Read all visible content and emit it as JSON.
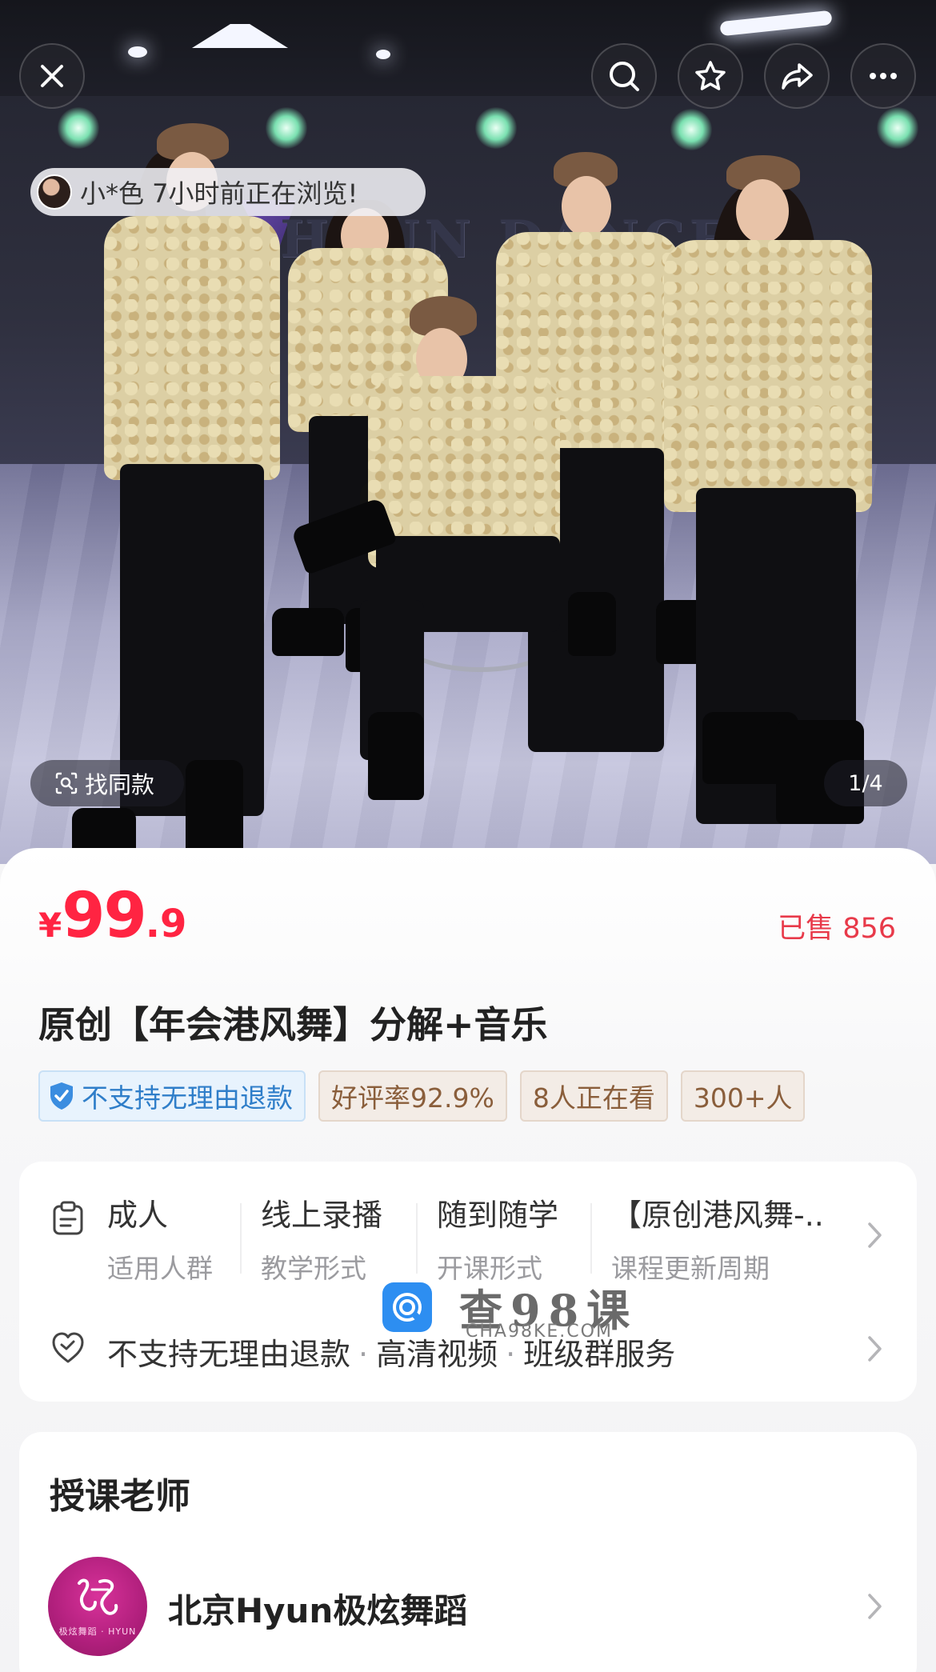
{
  "hero": {
    "sign_text": "HYUN DANCE",
    "viewer_notice": "小*色 7小时前正在浏览!",
    "find_similar_label": "找同款",
    "page_indicator": "1/4"
  },
  "topbar": {
    "icons": [
      "close-icon",
      "search-icon",
      "star-icon",
      "share-icon",
      "more-icon"
    ]
  },
  "product": {
    "price_currency": "¥",
    "price_integer": "99",
    "price_decimal": ".9",
    "sold_label": "已售 856",
    "title": "原创【年会港风舞】分解+音乐",
    "tags": [
      {
        "text": "不支持无理由退款",
        "type": "refund"
      },
      {
        "text": "好评率92.9%",
        "type": "gold"
      },
      {
        "text": "8人正在看",
        "type": "gold"
      },
      {
        "text": "300+人",
        "type": "gold"
      }
    ]
  },
  "attributes": [
    {
      "value": "成人",
      "key": "适用人群"
    },
    {
      "value": "线上录播",
      "key": "教学形式"
    },
    {
      "value": "随到随学",
      "key": "开课形式"
    },
    {
      "value": "【原创港风舞-..",
      "key": "课程更新周期"
    }
  ],
  "services": {
    "items": [
      "不支持无理由退款",
      "高清视频",
      "班级群服务"
    ],
    "separator": "·"
  },
  "watermark": {
    "main": "查98课",
    "sub": "CHA98KE.COM"
  },
  "teacher": {
    "heading": "授课老师",
    "name": "北京Hyun极炫舞蹈",
    "avatar_caption": "极炫舞蹈 · HYUN"
  },
  "colors": {
    "price_red": "#ff2442",
    "refund_blue": "#2f7ec9",
    "tag_brown": "#8a5e3b",
    "watermark_blue": "#2d8ef1",
    "avatar_magenta": "#b01f7c"
  }
}
